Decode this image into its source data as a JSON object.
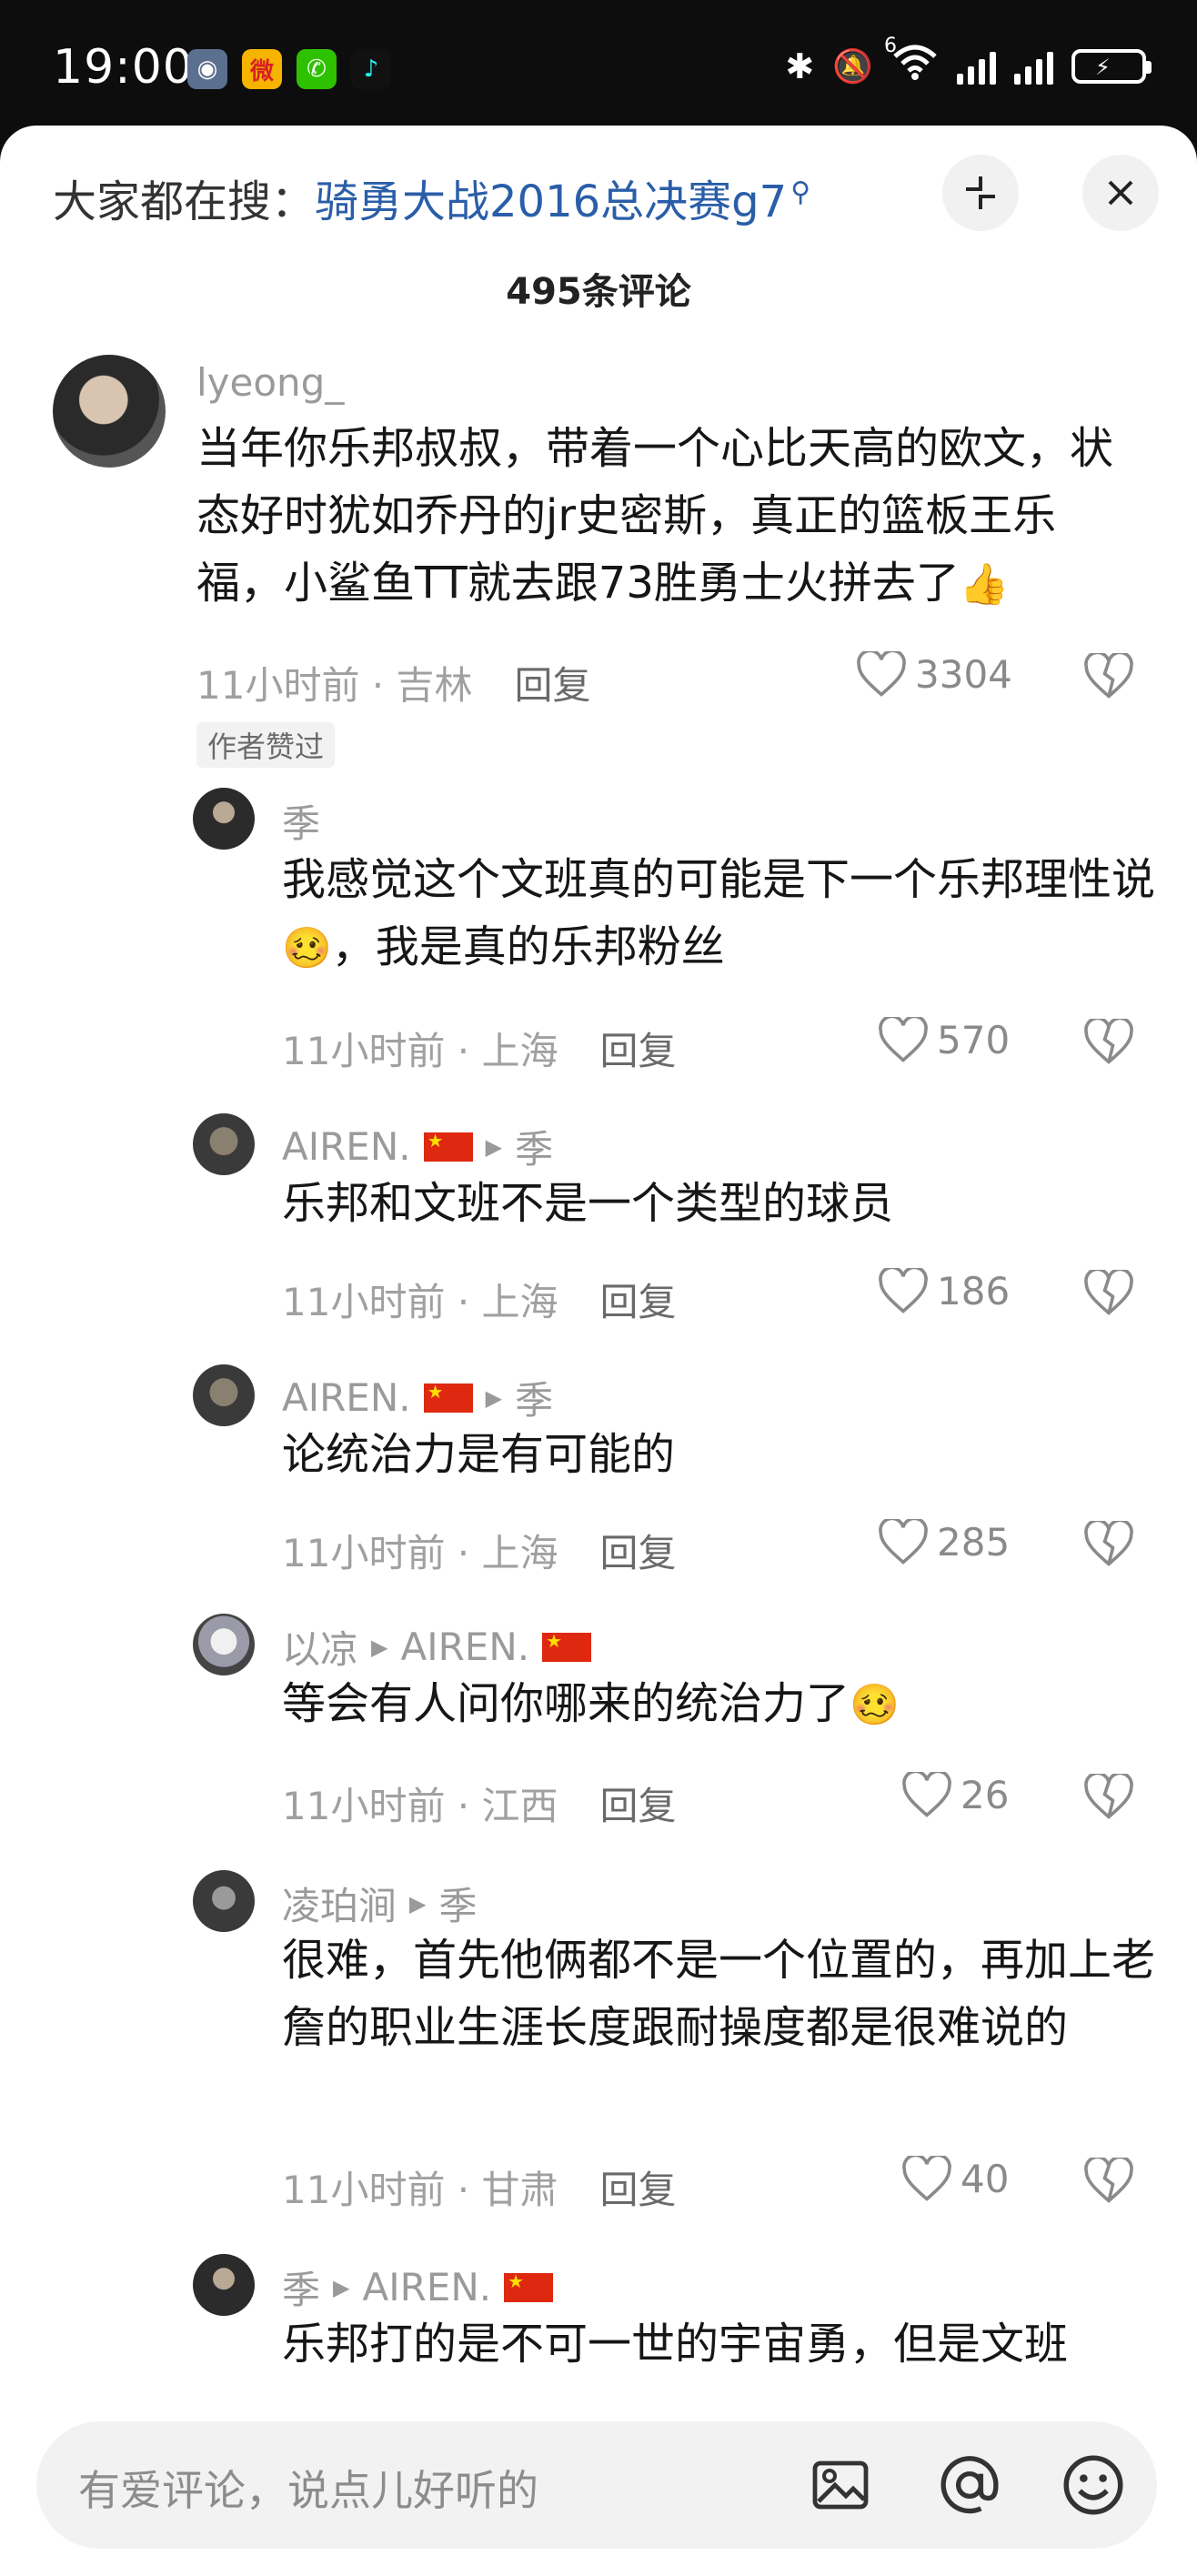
{
  "status_bar": {
    "time": "19:00",
    "net_tag": "6",
    "apps": [
      "weibo-icon",
      "wechat-icon",
      "tiktok-icon"
    ]
  },
  "search": {
    "prefix": "大家都在搜：",
    "term": "骑勇大战2016总决赛g7"
  },
  "comment_count": "495条评论",
  "comments": [
    {
      "author": "lyeong_",
      "text": "当年你乐邦叔叔，带着一个心比天高的欧文，状态好时犹如乔丹的jr史密斯，真正的篮板王乐福，小鲨鱼TT就去跟73胜勇士火拼去了",
      "emoji": "👍",
      "time": "11小时前",
      "location": "吉林",
      "reply_label": "回复",
      "likes": "3304",
      "badge": "作者赞过"
    },
    {
      "author": "季",
      "text": "我感觉这个文班真的可能是下一个乐邦理性说",
      "emoji": "🥴",
      "text2": "，我是真的乐邦粉丝",
      "time": "11小时前",
      "location": "上海",
      "reply_label": "回复",
      "likes": "570"
    },
    {
      "author": "AIREN.",
      "reply_to": "季",
      "text": "乐邦和文班不是一个类型的球员",
      "time": "11小时前",
      "location": "上海",
      "reply_label": "回复",
      "likes": "186"
    },
    {
      "author": "AIREN.",
      "reply_to": "季",
      "text": "论统治力是有可能的",
      "time": "11小时前",
      "location": "上海",
      "reply_label": "回复",
      "likes": "285"
    },
    {
      "author": "以凉",
      "reply_to": "AIREN.",
      "text": "等会有人问你哪来的统治力了",
      "emoji": "🥴",
      "time": "11小时前",
      "location": "江西",
      "reply_label": "回复",
      "likes": "26"
    },
    {
      "author": "凌珀涧",
      "reply_to": "季",
      "text": "很难，首先他俩都不是一个位置的，再加上老詹的职业生涯长度跟耐操度都是很难说的",
      "time": "11小时前",
      "location": "甘肃",
      "reply_label": "回复",
      "likes": "40"
    },
    {
      "author": "季",
      "reply_to": "AIREN.",
      "text": "乐邦打的是不可一世的宇宙勇，但是文班"
    }
  ],
  "input": {
    "placeholder": "有爱评论，说点儿好听的"
  },
  "colors": {
    "accent_link": "#2a5ea8",
    "meta_gray": "#a0a0a0",
    "flag_red": "#de2910"
  }
}
